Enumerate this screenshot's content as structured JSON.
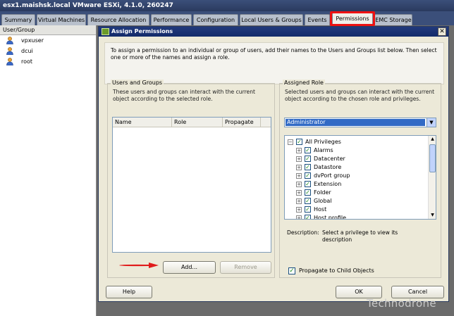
{
  "window": {
    "title": "esx1.maishsk.local VMware ESXi, 4.1.0, 260247"
  },
  "tabs": [
    {
      "label": "Summary"
    },
    {
      "label": "Virtual Machines"
    },
    {
      "label": "Resource Allocation"
    },
    {
      "label": "Performance"
    },
    {
      "label": "Configuration"
    },
    {
      "label": "Local Users & Groups"
    },
    {
      "label": "Events"
    },
    {
      "label": "Permissions"
    },
    {
      "label": "EMC Storage"
    }
  ],
  "left_panel": {
    "header": "User/Group",
    "users": [
      {
        "name": "vpxuser",
        "icon": "user-icon"
      },
      {
        "name": "dcui",
        "icon": "user-icon"
      },
      {
        "name": "root",
        "icon": "user-icon"
      }
    ]
  },
  "dialog": {
    "title": "Assign Permissions",
    "close_label": "✕",
    "intro": "To assign a permission to an individual or group of users, add their names to the Users and Groups list below. Then select one or more of the names and assign a role.",
    "users_groups": {
      "title": "Users and Groups",
      "description": "These users and groups can interact with the current object according to the selected role.",
      "columns": [
        "Name",
        "Role",
        "Propagate"
      ],
      "add_label": "Add...",
      "remove_label": "Remove"
    },
    "assigned_role": {
      "title": "Assigned Role",
      "description": "Selected users and groups can interact with the current object according to the chosen role and privileges.",
      "selected_role": "Administrator",
      "privileges_root": "All Privileges",
      "privileges": [
        "Alarms",
        "Datacenter",
        "Datastore",
        "dvPort group",
        "Extension",
        "Folder",
        "Global",
        "Host",
        "Host profile"
      ],
      "description_label": "Description:",
      "description_value": "Select a privilege to view its description",
      "propagate_label": "Propagate to Child Objects",
      "propagate_checked": true
    },
    "help_label": "Help",
    "ok_label": "OK",
    "cancel_label": "Cancel"
  },
  "watermark": "Technodrone",
  "colors": {
    "highlight_red": "#ee1111",
    "selection_blue": "#316ac5",
    "check_green": "#1a8a1a"
  }
}
